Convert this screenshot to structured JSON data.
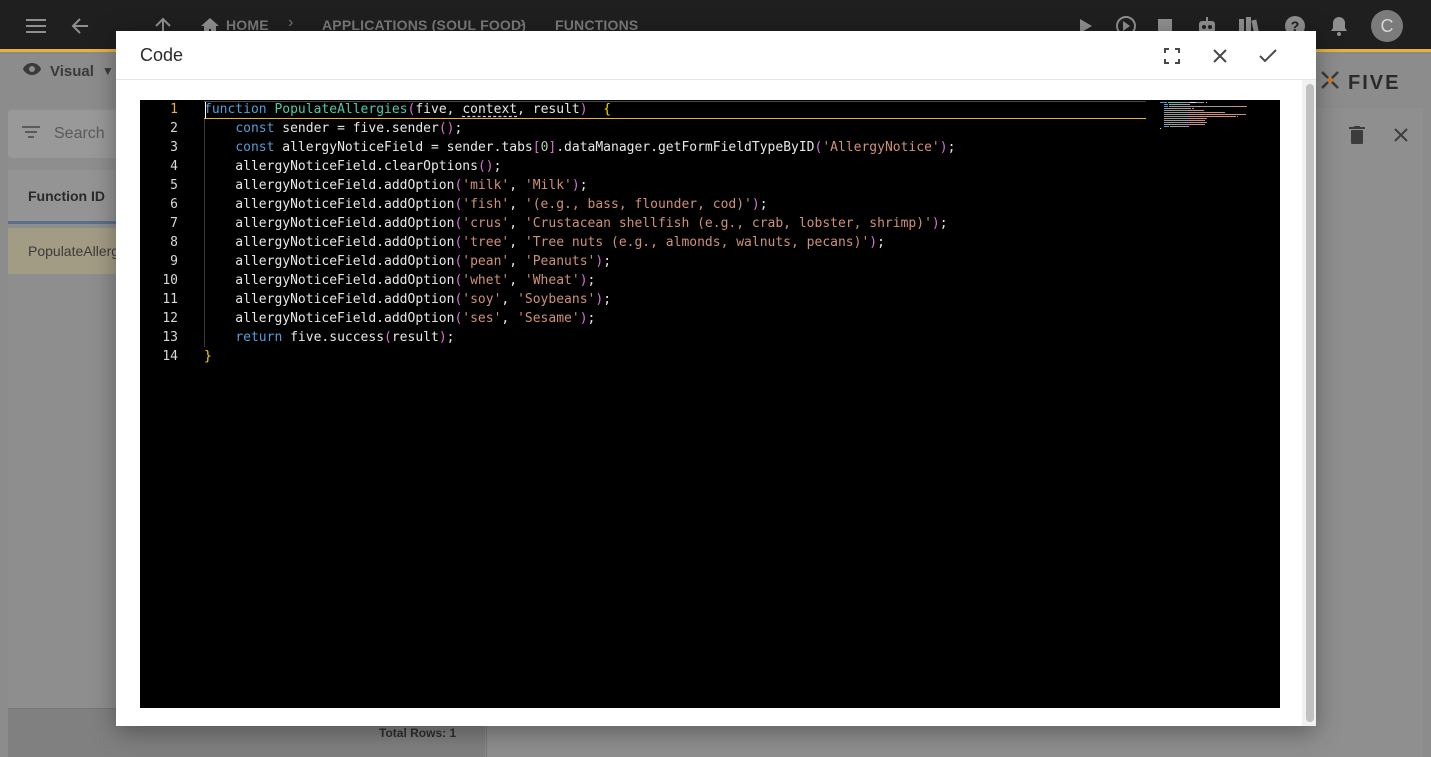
{
  "topbar": {
    "breadcrumbs": [
      "HOME",
      "APPLICATIONS (SOUL FOOD)",
      "FUNCTIONS"
    ],
    "avatar_initial": "C",
    "icons": [
      "menu-icon",
      "back-arrow-icon",
      "up-arrow-icon",
      "home-icon",
      "play-icon",
      "play-circle-icon",
      "stop-icon",
      "robot-icon",
      "library-icon",
      "help-icon",
      "bell-icon"
    ]
  },
  "background": {
    "view_mode": "Visual",
    "view_mode_caret": "▼",
    "logo_text": "FIVE",
    "search_placeholder": "Search",
    "column_header": "Function ID",
    "row_value": "PopulateAllergies",
    "total_rows": "Total Rows: 1"
  },
  "modal": {
    "title": "Code",
    "buttons": {
      "fullscreen": "fullscreen-icon",
      "close": "close-icon",
      "confirm": "check-icon"
    }
  },
  "editor": {
    "active_line": 1,
    "line_numbers": [
      "1",
      "2",
      "3",
      "4",
      "5",
      "6",
      "7",
      "8",
      "9",
      "10",
      "11",
      "12",
      "13",
      "14"
    ],
    "lines": [
      [
        [
          "kw",
          "function"
        ],
        [
          "t",
          " "
        ],
        [
          "fn",
          "PopulateAllergies"
        ],
        [
          "p2",
          "("
        ],
        [
          "t",
          "five, "
        ],
        [
          "sq",
          "context"
        ],
        [
          "t",
          ", result"
        ],
        [
          "p2",
          ")"
        ],
        [
          "t",
          "  "
        ],
        [
          "p1",
          "{"
        ]
      ],
      [
        [
          "t",
          "    "
        ],
        [
          "kw",
          "const"
        ],
        [
          "t",
          " sender = five.sender"
        ],
        [
          "p2",
          "()"
        ],
        [
          "t",
          ";"
        ]
      ],
      [
        [
          "t",
          "    "
        ],
        [
          "kw",
          "const"
        ],
        [
          "t",
          " allergyNoticeField = sender.tabs"
        ],
        [
          "p2",
          "["
        ],
        [
          "num",
          "0"
        ],
        [
          "p2",
          "]"
        ],
        [
          "t",
          ".dataManager.getFormFieldTypeByID"
        ],
        [
          "p2",
          "("
        ],
        [
          "str",
          "'AllergyNotice'"
        ],
        [
          "p2",
          ")"
        ],
        [
          "t",
          ";"
        ]
      ],
      [
        [
          "t",
          "    allergyNoticeField.clearOptions"
        ],
        [
          "p2",
          "()"
        ],
        [
          "t",
          ";"
        ]
      ],
      [
        [
          "t",
          "    allergyNoticeField.addOption"
        ],
        [
          "p2",
          "("
        ],
        [
          "str",
          "'milk'"
        ],
        [
          "t",
          ", "
        ],
        [
          "str",
          "'Milk'"
        ],
        [
          "p2",
          ")"
        ],
        [
          "t",
          ";"
        ]
      ],
      [
        [
          "t",
          "    allergyNoticeField.addOption"
        ],
        [
          "p2",
          "("
        ],
        [
          "str",
          "'fish'"
        ],
        [
          "t",
          ", "
        ],
        [
          "str",
          "'(e.g., bass, flounder, cod)'"
        ],
        [
          "p2",
          ")"
        ],
        [
          "t",
          ";"
        ]
      ],
      [
        [
          "t",
          "    allergyNoticeField.addOption"
        ],
        [
          "p2",
          "("
        ],
        [
          "str",
          "'crus'"
        ],
        [
          "t",
          ", "
        ],
        [
          "str",
          "'Crustacean shellfish (e.g., crab, lobster, shrimp)'"
        ],
        [
          "p2",
          ")"
        ],
        [
          "t",
          ";"
        ]
      ],
      [
        [
          "t",
          "    allergyNoticeField.addOption"
        ],
        [
          "p2",
          "("
        ],
        [
          "str",
          "'tree'"
        ],
        [
          "t",
          ", "
        ],
        [
          "str",
          "'Tree nuts (e.g., almonds, walnuts, pecans)'"
        ],
        [
          "p2",
          ")"
        ],
        [
          "t",
          ";"
        ]
      ],
      [
        [
          "t",
          "    allergyNoticeField.addOption"
        ],
        [
          "p2",
          "("
        ],
        [
          "str",
          "'pean'"
        ],
        [
          "t",
          ", "
        ],
        [
          "str",
          "'Peanuts'"
        ],
        [
          "p2",
          ")"
        ],
        [
          "t",
          ";"
        ]
      ],
      [
        [
          "t",
          "    allergyNoticeField.addOption"
        ],
        [
          "p2",
          "("
        ],
        [
          "str",
          "'whet'"
        ],
        [
          "t",
          ", "
        ],
        [
          "str",
          "'Wheat'"
        ],
        [
          "p2",
          ")"
        ],
        [
          "t",
          ";"
        ]
      ],
      [
        [
          "t",
          "    allergyNoticeField.addOption"
        ],
        [
          "p2",
          "("
        ],
        [
          "str",
          "'soy'"
        ],
        [
          "t",
          ", "
        ],
        [
          "str",
          "'Soybeans'"
        ],
        [
          "p2",
          ")"
        ],
        [
          "t",
          ";"
        ]
      ],
      [
        [
          "t",
          "    allergyNoticeField.addOption"
        ],
        [
          "p2",
          "("
        ],
        [
          "str",
          "'ses'"
        ],
        [
          "t",
          ", "
        ],
        [
          "str",
          "'Sesame'"
        ],
        [
          "p2",
          ")"
        ],
        [
          "t",
          ";"
        ]
      ],
      [
        [
          "t",
          "    "
        ],
        [
          "kw",
          "return"
        ],
        [
          "t",
          " five.success"
        ],
        [
          "p2",
          "("
        ],
        [
          "t",
          "result"
        ],
        [
          "p2",
          ")"
        ],
        [
          "t",
          ";"
        ]
      ],
      [
        [
          "p1",
          "}"
        ]
      ]
    ]
  },
  "colors": {
    "accent": "#e8b13a",
    "keyword": "#569cd6",
    "function_name": "#4ec9b0",
    "string": "#ce9178",
    "bracket_level1": "#ffd700",
    "bracket_level2": "#da70d6",
    "editor_bg": "#000000"
  }
}
